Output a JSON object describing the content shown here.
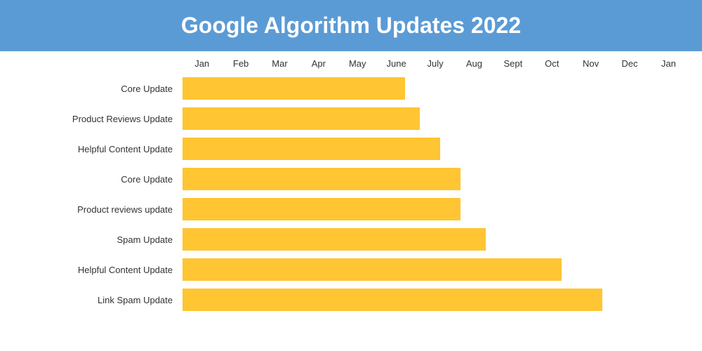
{
  "header": {
    "title": "Google Algorithm Updates 2022"
  },
  "axis": {
    "months": [
      "Jan",
      "Feb",
      "Mar",
      "Apr",
      "May",
      "June",
      "July",
      "Aug",
      "Sept",
      "Oct",
      "Nov",
      "Dec",
      "Jan"
    ]
  },
  "rows": [
    {
      "label": "Core Update",
      "width_pct": 44
    },
    {
      "label": "Product Reviews Update",
      "width_pct": 47
    },
    {
      "label": "Helpful Content Update",
      "width_pct": 51
    },
    {
      "label": "Core Update",
      "width_pct": 55
    },
    {
      "label": "Product reviews update",
      "width_pct": 55
    },
    {
      "label": "Spam Update",
      "width_pct": 60
    },
    {
      "label": "Helpful Content Update",
      "width_pct": 75
    },
    {
      "label": "Link Spam Update",
      "width_pct": 83
    }
  ],
  "colors": {
    "header_bg": "#5b9bd5",
    "bar_fill": "#ffc532"
  }
}
